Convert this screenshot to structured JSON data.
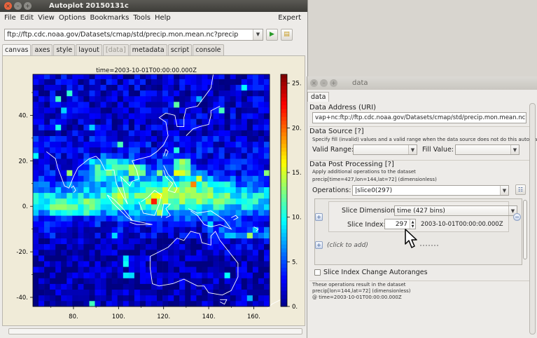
{
  "main_window": {
    "title": "Autoplot 20150131c",
    "menu": [
      "File",
      "Edit",
      "View",
      "Options",
      "Bookmarks",
      "Tools",
      "Help"
    ],
    "expert_label": "Expert",
    "url": "ftp://ftp.cdc.noaa.gov/Datasets/cmap/std/precip.mon.mean.nc?precip",
    "tabs": [
      {
        "label": "canvas",
        "active": true,
        "disabled": false
      },
      {
        "label": "axes",
        "active": false,
        "disabled": false
      },
      {
        "label": "style",
        "active": false,
        "disabled": false
      },
      {
        "label": "layout",
        "active": false,
        "disabled": false
      },
      {
        "label": "[data]",
        "active": false,
        "disabled": true
      },
      {
        "label": "metadata",
        "active": false,
        "disabled": false
      },
      {
        "label": "script",
        "active": false,
        "disabled": false
      },
      {
        "label": "console",
        "active": false,
        "disabled": false
      }
    ]
  },
  "plot": {
    "title": "time=2003-10-01T00:00:00.000Z",
    "x_ticks": [
      "80.",
      "100.",
      "120.",
      "140.",
      "160."
    ],
    "y_ticks": [
      "40.",
      "20.",
      "0.",
      "-20.",
      "-40."
    ],
    "colorbar_ticks": [
      "25.",
      "20.",
      "15.",
      "10.",
      "5.",
      "0."
    ],
    "colors": {
      "background": "#f0ebd8",
      "coast": "#ffffff"
    }
  },
  "chart_data": {
    "type": "heatmap",
    "title": "time=2003-10-01T00:00:00.000Z",
    "xlabel": "",
    "ylabel": "",
    "xlim": [
      62,
      167
    ],
    "ylim": [
      -44,
      58
    ],
    "zlim": [
      0,
      26
    ],
    "xticks": [
      80,
      100,
      120,
      140,
      160
    ],
    "yticks": [
      40,
      20,
      0,
      -20,
      -40
    ],
    "zticks": [
      25,
      20,
      15,
      10,
      5,
      0
    ],
    "colormap": "jet",
    "grid": false,
    "overlay": "coastlines",
    "regions": [
      {
        "lon": [
          88,
          104
        ],
        "lat": [
          12,
          22
        ],
        "precip": 12
      },
      {
        "lon": [
          105,
          112
        ],
        "lat": [
          14,
          18
        ],
        "precip": 18
      },
      {
        "lon": [
          124,
          132
        ],
        "lat": [
          14,
          20
        ],
        "precip": 22
      },
      {
        "lon": [
          96,
          104
        ],
        "lat": [
          2,
          8
        ],
        "precip": 15
      },
      {
        "lon": [
          70,
          92
        ],
        "lat": [
          -4,
          4
        ],
        "precip": 14
      },
      {
        "lon": [
          120,
          150
        ],
        "lat": [
          2,
          10
        ],
        "precip": 12
      },
      {
        "lon": [
          140,
          166
        ],
        "lat": [
          -22,
          -8
        ],
        "precip": 8
      },
      {
        "lon": [
          62,
          166
        ],
        "lat": [
          -44,
          -14
        ],
        "precip": 2
      },
      {
        "lon": [
          62,
          166
        ],
        "lat": [
          24,
          58
        ],
        "precip": 3
      }
    ]
  },
  "data_window": {
    "title": "data",
    "tab": "data",
    "address_label": "Data Address (URI)",
    "address_value": "vap+nc:ftp://ftp.cdc.noaa.gov/Datasets/cmap/std/precip.mon.mean.nc?precip",
    "source_label": "Data Source [?]",
    "source_hint": "Specify fill (invalid) values and a valid range when the data source does not do this automatically",
    "valid_range_label": "Valid Range:",
    "fill_value_label": "Fill Value:",
    "post_label": "Data Post Processing [?]",
    "post_hint": "Apply additional operations to the dataset",
    "post_dims": "precip[time=427,lon=144,lat=72] (dimensionless)",
    "operations_label": "Operations:",
    "operations_value": "|slice0(297)",
    "slice_dim_label": "Slice Dimension:",
    "slice_dim_value": "time (427 bins)",
    "slice_index_label": "Slice Index:",
    "slice_index_value": "297",
    "slice_time": "2003-10-01T00:00:00.000Z",
    "click_to_add": "(click to add)",
    "autorange_label": "Slice Index Change Autoranges",
    "result_line1": "These operations result in the dataset",
    "result_line2": "precip[lon=144,lat=72] (dimensionless)",
    "result_line3": "@ time=2003-10-01T00:00:00.000Z"
  }
}
